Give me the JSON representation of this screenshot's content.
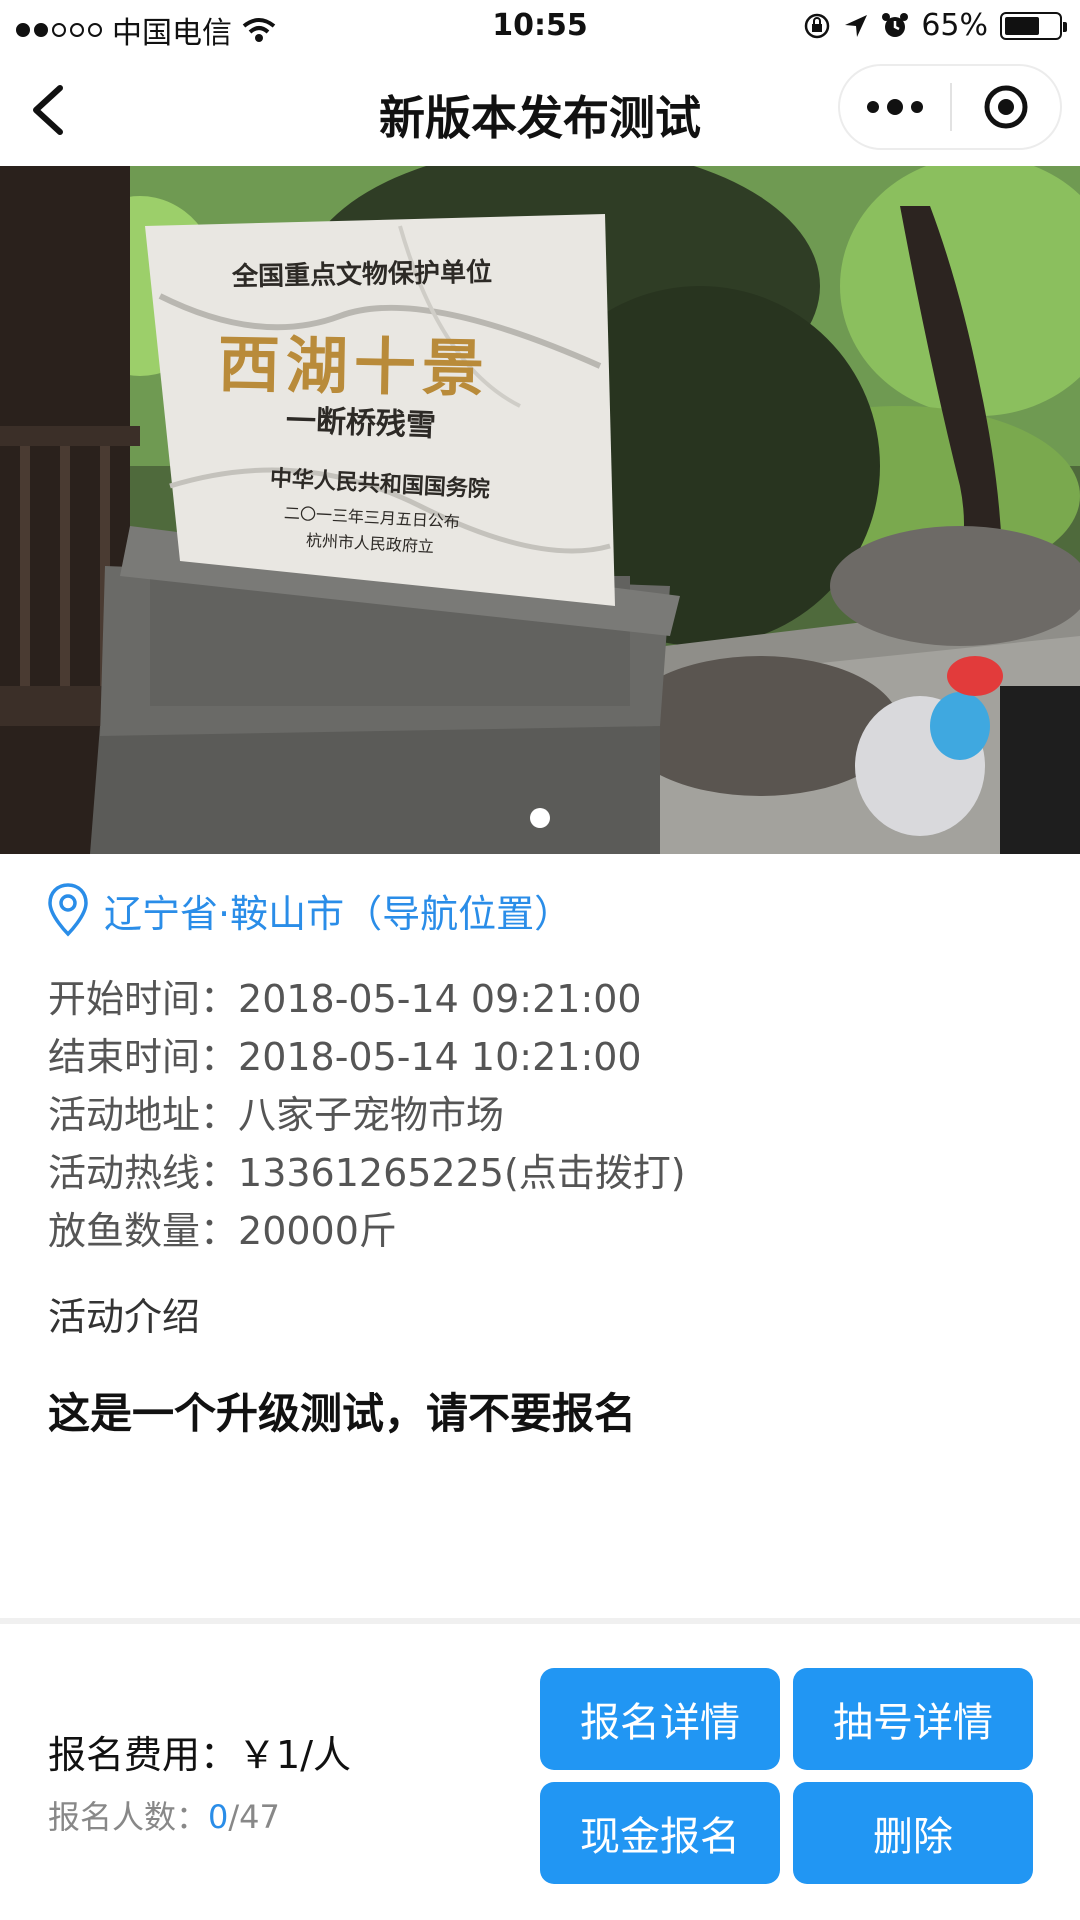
{
  "status_bar": {
    "carrier": "中国电信",
    "time": "10:55",
    "battery": "65%",
    "battery_level": 0.65
  },
  "nav": {
    "title": "新版本发布测试"
  },
  "hero_image": {
    "plaque_line1": "全国重点文物保护单位",
    "plaque_title": "西湖十景",
    "plaque_subtitle": "一断桥残雪",
    "plaque_line3": "中华人民共和国国务院",
    "plaque_line4": "二〇一三年三月五日公布",
    "plaque_line5": "杭州市人民政府立",
    "slide_count": 1,
    "active_slide": 1
  },
  "location": {
    "text": "辽宁省·鞍山市（导航位置）"
  },
  "info": {
    "rows": [
      {
        "label": "开始时间：",
        "value": "2018-05-14 09:21:00"
      },
      {
        "label": "结束时间：",
        "value": "2018-05-14 10:21:00"
      },
      {
        "label": "活动地址：",
        "value": "八家子宠物市场"
      },
      {
        "label": "活动热线：",
        "value": "13361265225(点击拨打)"
      },
      {
        "label": "放鱼数量：",
        "value": "20000斤"
      }
    ]
  },
  "intro": {
    "label": "活动介绍",
    "text": "这是一个升级测试，请不要报名"
  },
  "bottom": {
    "fee_label": "报名费用：",
    "fee_value": "￥1/人",
    "count_label": "报名人数：",
    "count_current": "0",
    "count_total": "/47",
    "buttons": {
      "signup_detail": "报名详情",
      "draw_detail": "抽号详情",
      "cash_signup": "现金报名",
      "delete": "删除"
    }
  },
  "colors": {
    "accent": "#2a8de8",
    "button": "#2196f3"
  }
}
